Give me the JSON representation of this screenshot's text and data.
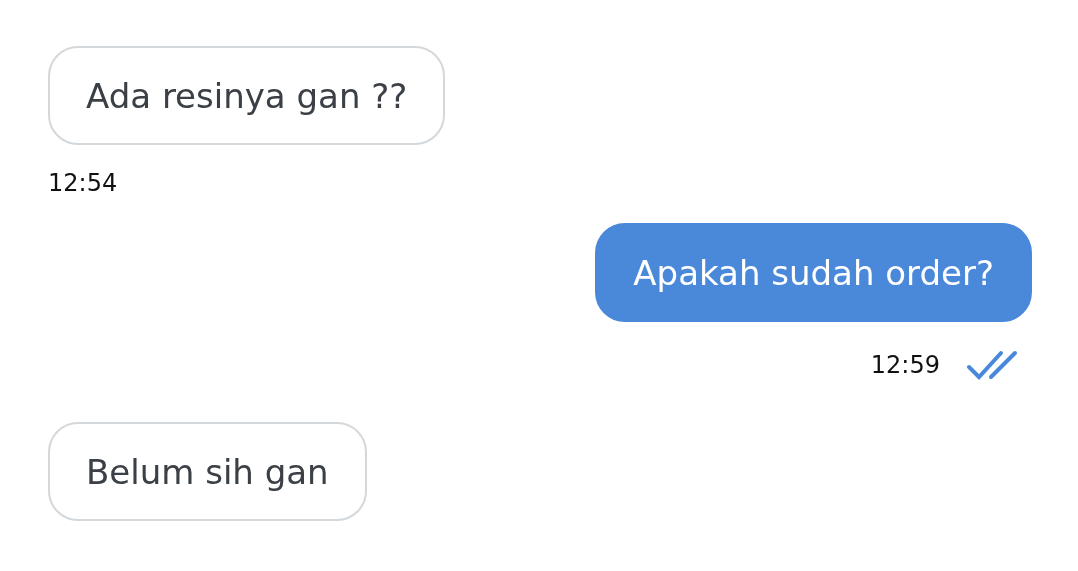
{
  "messages": [
    {
      "kind": "incoming",
      "text": "Ada resinya gan ??",
      "time": "12:54"
    },
    {
      "kind": "outgoing",
      "text": "Apakah sudah order?",
      "time": "12:59",
      "read": true
    },
    {
      "kind": "incoming",
      "text": "Belum sih gan"
    }
  ]
}
